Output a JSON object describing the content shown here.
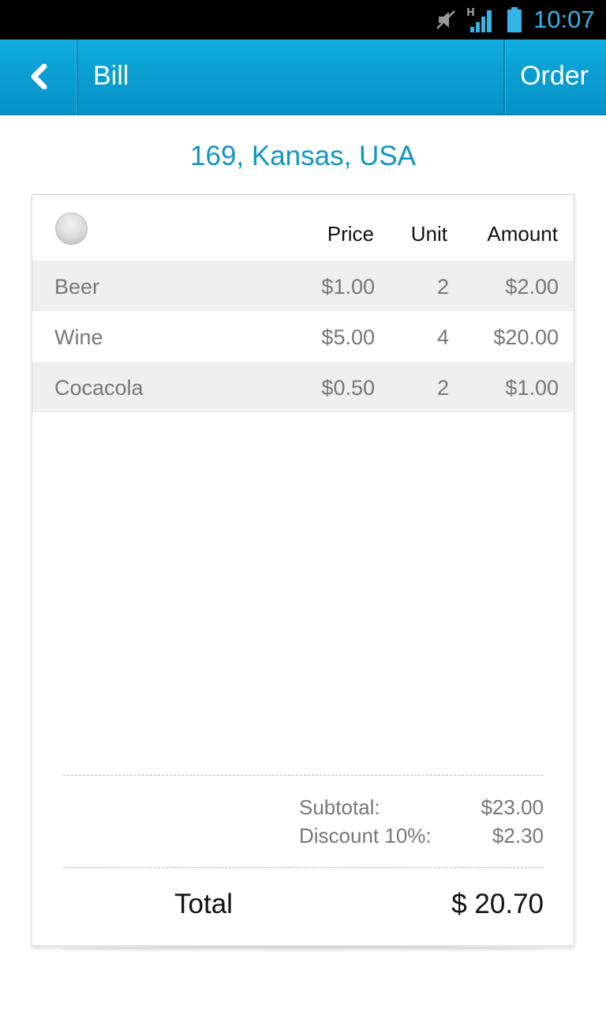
{
  "status_bar": {
    "time": "10:07",
    "network_label": "H",
    "icons": [
      "mute-icon",
      "signal-icon",
      "battery-icon"
    ],
    "time_color": "#33b5e5"
  },
  "action_bar": {
    "back_icon": "chevron-left-icon",
    "title": "Bill",
    "order_label": "Order",
    "color": "#0a9ed2"
  },
  "address": "169, Kansas, USA",
  "table": {
    "headers": {
      "price": "Price",
      "unit": "Unit",
      "amount": "Amount"
    },
    "rows": [
      {
        "name": "Beer",
        "price": "$1.00",
        "unit": "2",
        "amount": "$2.00"
      },
      {
        "name": "Wine",
        "price": "$5.00",
        "unit": "4",
        "amount": "$20.00"
      },
      {
        "name": "Cocacola",
        "price": "$0.50",
        "unit": "2",
        "amount": "$1.00"
      }
    ]
  },
  "summary": {
    "subtotal_label": "Subtotal:",
    "subtotal_value": "$23.00",
    "discount_label": "Discount 10%:",
    "discount_value": "$2.30",
    "total_label": "Total",
    "total_value": "$ 20.70"
  }
}
